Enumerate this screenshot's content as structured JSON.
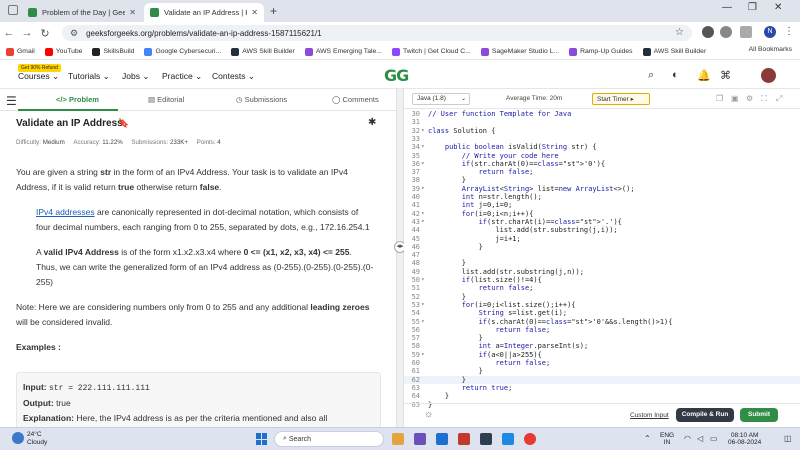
{
  "browser": {
    "tabs": [
      {
        "title": "Problem of the Day | GeeksforGeeks",
        "active": false
      },
      {
        "title": "Validate an IP Address | Practice",
        "active": true
      }
    ],
    "url": "geeksforgeeks.org/problems/validate-an-ip-address-1587115621/1",
    "profile_initial": "N",
    "bookmarks": [
      "Gmail",
      "YouTube",
      "SkillsBuild",
      "Google Cybersecuri...",
      "AWS Skill Builder",
      "AWS Emerging Tale...",
      "Twitch | Get Cloud C...",
      "SageMaker Studio L...",
      "Ramp-Up Guides",
      "AWS Skill Builder"
    ],
    "all_bookmarks": "All Bookmarks"
  },
  "site": {
    "promo": "Get 90% Refund",
    "menu": [
      "Courses",
      "Tutorials",
      "Jobs",
      "Practice",
      "Contests"
    ],
    "logo": "GG"
  },
  "problem": {
    "tabs": [
      "Problem",
      "Editorial",
      "Submissions",
      "Comments"
    ],
    "title": "Validate an IP Address",
    "difficulty_label": "Difficulty:",
    "difficulty": "Medium",
    "accuracy_label": "Accuracy:",
    "accuracy": "11.22%",
    "submissions_label": "Submissions:",
    "submissions": "233K+",
    "points_label": "Points:",
    "points": "4",
    "p1_a": "You are given a string ",
    "p1_b": "str",
    "p1_c": " in the form of an IPv4 Address. Your task is to validate an IPv4 Address, if it is valid return ",
    "p1_d": "true",
    "p1_e": " otherwise return ",
    "p1_f": "false",
    "p1_g": ".",
    "p2_link": "IPv4 addresses",
    "p2_rest": " are canonically represented in dot-decimal notation, which consists of four decimal numbers, each ranging from 0 to 255, separated by dots, e.g., 172.16.254.1",
    "p3_a": "A ",
    "p3_b": "valid IPv4 Address",
    "p3_c": " is of the form x1.x2.x3.x4 where ",
    "p3_d": "0 <= (x1, x2, x3, x4) <= 255",
    "p3_e": ". Thus, we can write the generalized form of an IPv4 address as (0-255).(0-255).(0-255).(0-255)",
    "p4_a": "Note: Here we are considering numbers only from 0 to 255 and any additional ",
    "p4_b": "leading zeroes",
    "p4_c": " will be considered invalid.",
    "examples_label": "Examples :",
    "ex_input_label": "Input:",
    "ex_input": "str = 222.111.111.111",
    "ex_output_label": "Output:",
    "ex_output": "true",
    "ex_expl_label": "Explanation:",
    "ex_expl": "Here, the IPv4 address is as per the criteria mentioned and also all"
  },
  "editor": {
    "language": "Java (1.8)",
    "avg_time": "Average Time: 20m",
    "timer_label": "Start Timer",
    "code_lines": [
      {
        "n": "30",
        "t": "// User function Template for Java"
      },
      {
        "n": "31",
        "t": ""
      },
      {
        "n": "32",
        "t": "class Solution {"
      },
      {
        "n": "33",
        "t": ""
      },
      {
        "n": "34",
        "t": "    public boolean isValid(String str) {"
      },
      {
        "n": "35",
        "t": "        // Write your code here"
      },
      {
        "n": "36",
        "t": "        if(str.charAt(0)=='0'){"
      },
      {
        "n": "37",
        "t": "            return false;"
      },
      {
        "n": "38",
        "t": "        }"
      },
      {
        "n": "39",
        "t": "        ArrayList<String> list=new ArrayList<>();"
      },
      {
        "n": "40",
        "t": "        int n=str.length();"
      },
      {
        "n": "41",
        "t": "        int j=0,i=0;"
      },
      {
        "n": "42",
        "t": "        for(i=0;i<n;i++){"
      },
      {
        "n": "43",
        "t": "            if(str.charAt(i)=='.'){"
      },
      {
        "n": "44",
        "t": "                list.add(str.substring(j,i));"
      },
      {
        "n": "45",
        "t": "                j=i+1;"
      },
      {
        "n": "46",
        "t": "            }"
      },
      {
        "n": "47",
        "t": ""
      },
      {
        "n": "48",
        "t": "        }"
      },
      {
        "n": "49",
        "t": "        list.add(str.substring(j,n));"
      },
      {
        "n": "50",
        "t": "        if(list.size()!=4){"
      },
      {
        "n": "51",
        "t": "            return false;"
      },
      {
        "n": "52",
        "t": "        }"
      },
      {
        "n": "53",
        "t": "        for(i=0;i<list.size();i++){"
      },
      {
        "n": "54",
        "t": "            String s=list.get(i);"
      },
      {
        "n": "55",
        "t": "            if(s.charAt(0)=='0'&&s.length()>1){"
      },
      {
        "n": "56",
        "t": "                return false;"
      },
      {
        "n": "57",
        "t": "            }"
      },
      {
        "n": "58",
        "t": "            int a=Integer.parseInt(s);"
      },
      {
        "n": "59",
        "t": "            if(a<0||a>255){"
      },
      {
        "n": "60",
        "t": "                return false;"
      },
      {
        "n": "61",
        "t": "            }"
      },
      {
        "n": "62",
        "t": "        }"
      },
      {
        "n": "63",
        "t": "        return true;"
      },
      {
        "n": "64",
        "t": "    }"
      },
      {
        "n": "65",
        "t": "}"
      }
    ],
    "highlight_line": "62",
    "custom_input": "Custom Input",
    "compile_run": "Compile & Run",
    "submit": "Submit"
  },
  "taskbar": {
    "temp": "24°C",
    "weather": "Cloudy",
    "search_placeholder": "Search",
    "lang_top": "ENG",
    "lang_bottom": "IN",
    "time": "08:10 AM",
    "date": "06-08-2024"
  },
  "colors": {
    "brand_green": "#2f8d46",
    "compile_bg": "#333a45",
    "link_blue": "#1a5fb4"
  }
}
